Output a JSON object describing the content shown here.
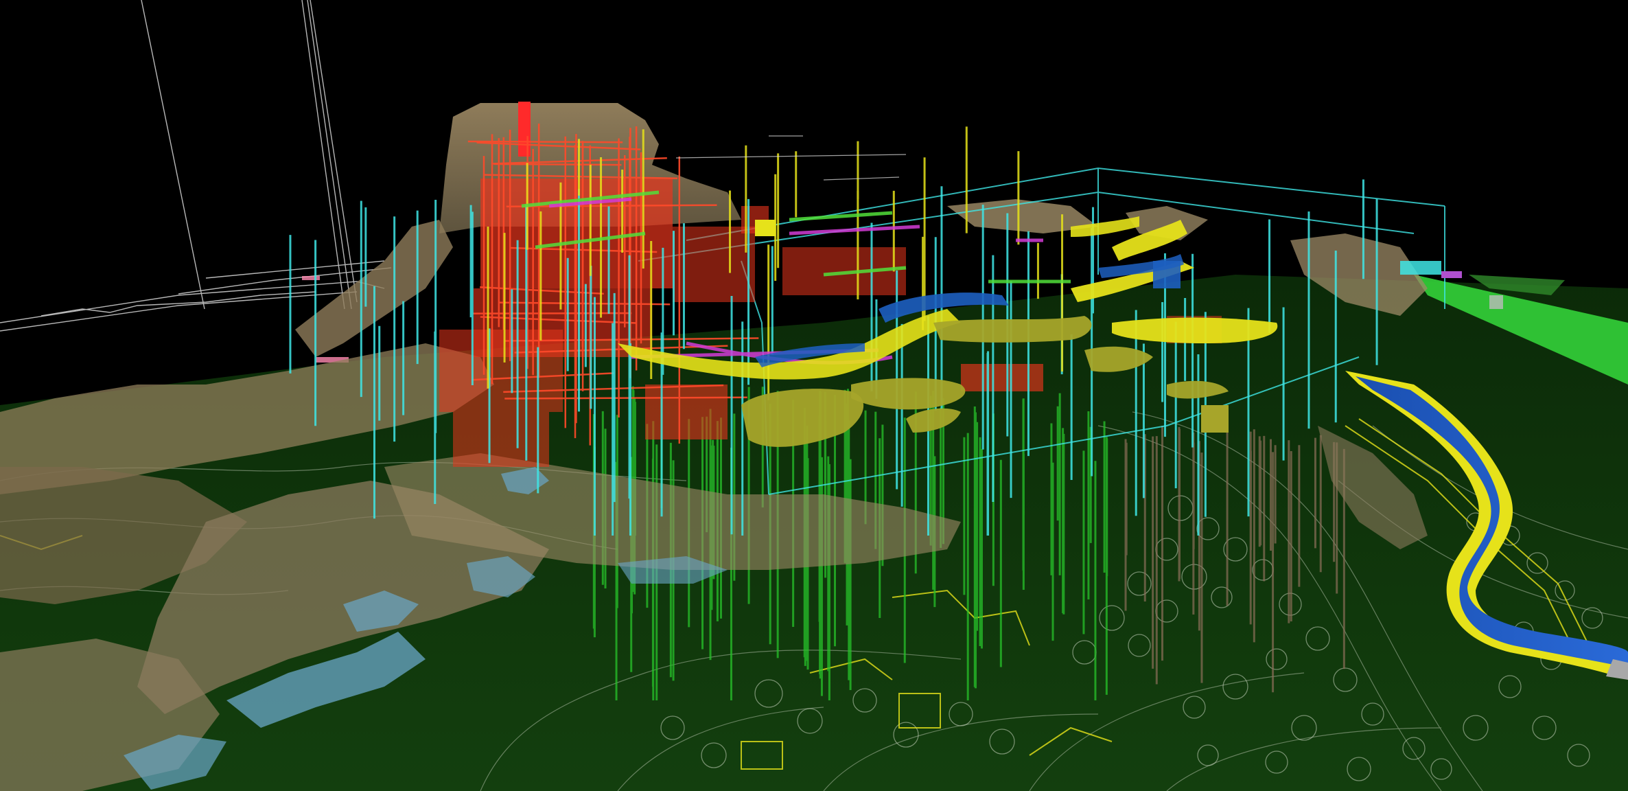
{
  "scene": {
    "kind": "3D BIM model view",
    "background": "#000000",
    "ground_color": "#0f3a0c",
    "colors": {
      "rock": "#9c8a66",
      "steel_red": "#e8341c",
      "column_cyan": "#3fe6e6",
      "slab_yellow": "#e6e21a",
      "water_blue": "#1d5fc0",
      "pile_green": "#27c22a",
      "magenta": "#d23cd6",
      "cad_lines": "#d8d8d8",
      "site_green": "#33d13a"
    }
  }
}
